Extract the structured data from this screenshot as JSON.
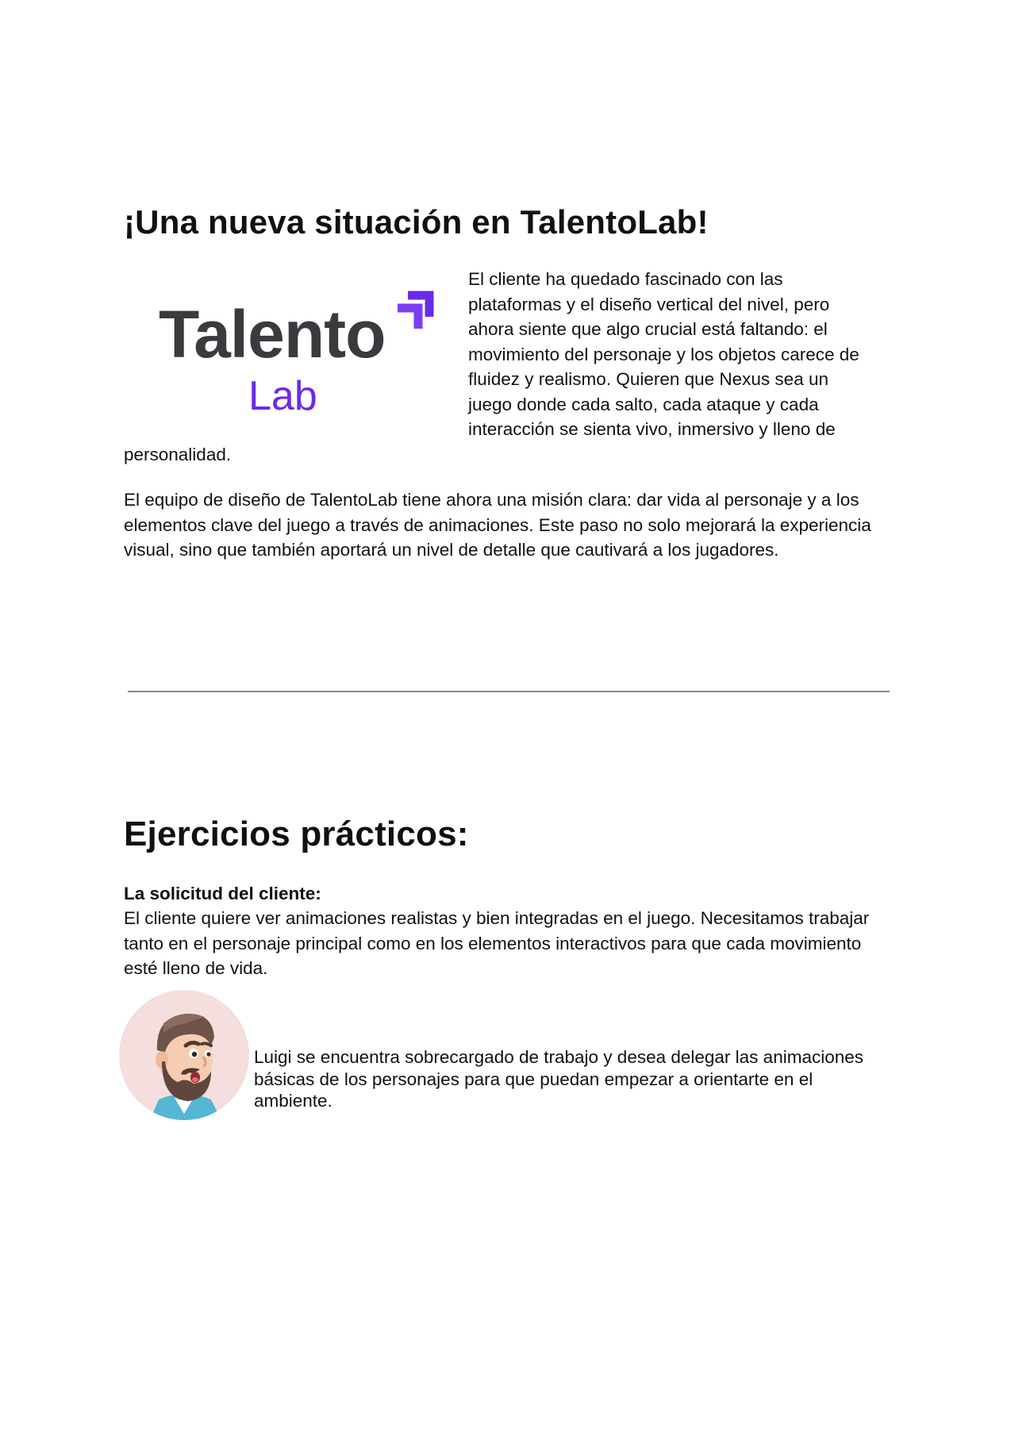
{
  "section1": {
    "title": "¡Una nueva situación en TalentoLab!",
    "logo": {
      "word_top": "Talento",
      "word_bottom": "Lab",
      "colors": {
        "text_dark": "#3a3a3f",
        "accent": "#6a2be8",
        "accent_light": "#7d3ef3"
      }
    },
    "paragraph1_lines": [
      "El cliente ha quedado fascinado con las",
      "plataformas y el diseño vertical del nivel, pero",
      "ahora siente que algo crucial está faltando: el",
      "movimiento del personaje y los objetos carece de",
      "fluidez y realismo. Quieren que Nexus sea un",
      "juego donde cada salto, cada ataque y cada",
      "interacción se sienta vivo, inmersivo y lleno de"
    ],
    "paragraph1_tail": "personalidad.",
    "paragraph2": "El equipo de diseño de TalentoLab tiene ahora una misión clara: dar vida al personaje y a los elementos clave del juego a través de animaciones. Este paso no solo mejorará la experiencia visual, sino que también aportará un nivel de detalle que cautivará a los jugadores."
  },
  "section2": {
    "title": "Ejercicios prácticos:",
    "request_label": "La solicitud del cliente:",
    "request_text": "El cliente quiere ver animaciones realistas y bien integradas en el juego. Necesitamos trabajar tanto en el personaje principal como en los elementos interactivos para que cada movimiento esté lleno de vida.",
    "avatar_icon": "bearded-man-avatar-icon",
    "luigi_text": "Luigi se encuentra sobrecargado de trabajo y desea delegar las animaciones básicas de los personajes para que puedan empezar a orientarte en el ambiente."
  }
}
